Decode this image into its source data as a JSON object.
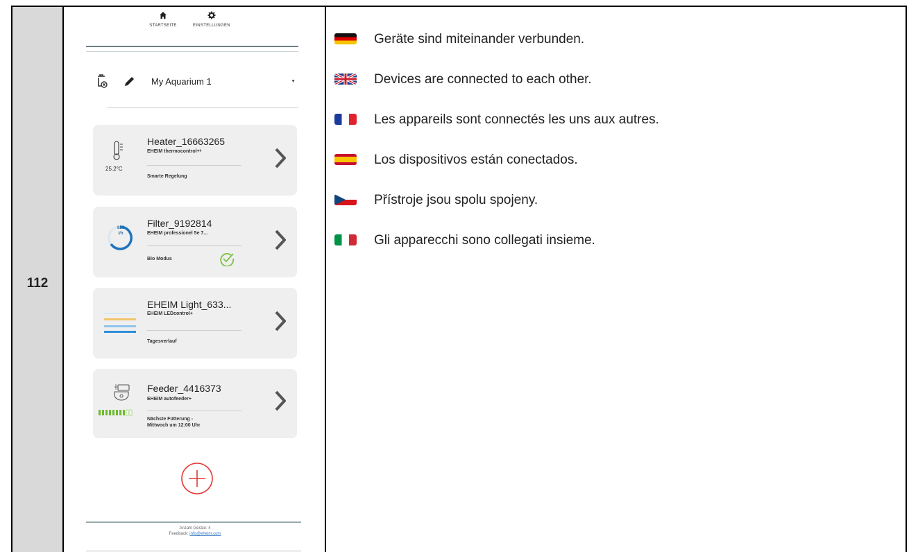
{
  "row_number": "112",
  "app": {
    "nav": {
      "home_label": "STARTSEITE",
      "settings_label": "EINSTELLUNGEN"
    },
    "aquarium": {
      "name": "My Aquarium 1"
    },
    "devices": [
      {
        "title": "Heater_16663265",
        "model": "EHEIM thermocontrol+ᵉ",
        "status": "Smarte Regelung",
        "reading": "25.2°C"
      },
      {
        "title": "Filter_9192814",
        "model": "EHEIM professionel 5e 7...",
        "status": "Bio Modus",
        "reading_value": "825",
        "reading_unit": "l/h"
      },
      {
        "title": "EHEIM Light_633...",
        "model": "EHEIM LEDcontrol+",
        "status": "Tagesverlauf"
      },
      {
        "title": "Feeder_4416373",
        "model": "EHEIM autofeeder+",
        "status_line1": "Nächste Fütterung -",
        "status_line2": "Mittwoch um 12:00 Uhr"
      }
    ],
    "footer": {
      "count": "Anzahl Geräte: 4",
      "feedback_label": "Feedback:",
      "feedback_email": "info@eheim.com"
    }
  },
  "translations": [
    {
      "lang": "de",
      "text": "Geräte sind miteinander verbunden."
    },
    {
      "lang": "en",
      "text": "Devices are connected to each other."
    },
    {
      "lang": "fr",
      "text": "Les appareils sont connectés les uns aux autres."
    },
    {
      "lang": "es",
      "text": "Los dispositivos están conectados."
    },
    {
      "lang": "cz",
      "text": "Přístroje jsou spolu spojeny."
    },
    {
      "lang": "it",
      "text": "Gli apparecchi sono collegati insieme."
    }
  ],
  "colors": {
    "accent_blue": "#1e73be",
    "add_red": "#e53935",
    "check_green": "#7cc242",
    "feeder_green": "#6dbb2f"
  }
}
